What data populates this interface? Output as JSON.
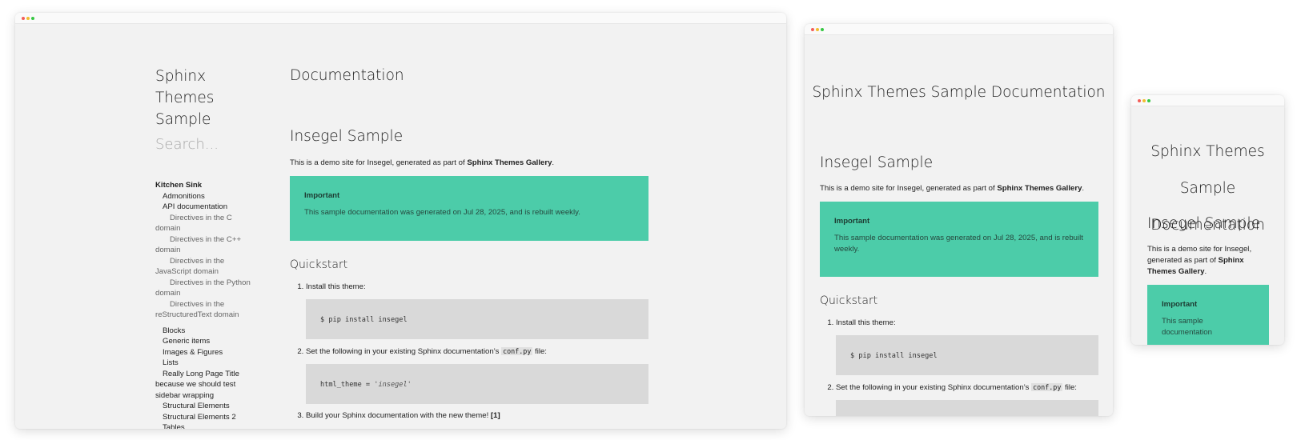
{
  "site": {
    "title": "Sphinx Themes Sample Documentation",
    "title_line1": "Sphinx Themes",
    "title_line2": "Sample",
    "doc_word": "Documentation",
    "search_placeholder": "Search..."
  },
  "sidebar": {
    "top_label": "Kitchen Sink",
    "items": [
      {
        "label": "Admonitions",
        "level": 2
      },
      {
        "label": "API documentation",
        "level": 2
      },
      {
        "label": "Directives in the C domain",
        "level": 3
      },
      {
        "label": "Directives in the C++ domain",
        "level": 3
      },
      {
        "label": "Directives in the JavaScript domain",
        "level": 3
      },
      {
        "label": "Directives in the Python domain",
        "level": 3
      },
      {
        "label": "Directives in the reStructuredText domain",
        "level": 3
      },
      {
        "label": "Blocks",
        "level": 2
      },
      {
        "label": "Generic items",
        "level": 2
      },
      {
        "label": "Images & Figures",
        "level": 2
      },
      {
        "label": "Lists",
        "level": 2
      },
      {
        "label": "Really Long Page Title because we should test sidebar wrapping",
        "level": 2
      },
      {
        "label": "Structural Elements",
        "level": 2
      },
      {
        "label": "Structural Elements 2",
        "level": 2
      },
      {
        "label": "Tables",
        "level": 2
      }
    ]
  },
  "page": {
    "heading": "Insegel Sample",
    "intro_prefix": "This is a demo site for Insegel, generated as part of ",
    "intro_link": "Sphinx Themes Gallery",
    "intro_suffix": ".",
    "admonition_title": "Important",
    "admonition_body": "This sample documentation was generated on Jul 28, 2025, and is rebuilt weekly.",
    "admonition_body_short": "This sample documentation",
    "quickstart_heading": "Quickstart",
    "step1": "Install this theme:",
    "step1_code": "$ pip install insegel",
    "step2_prefix": "Set the following in your existing Sphinx documentation’s ",
    "step2_code_inline": "conf.py",
    "step2_suffix": " file:",
    "step2_code_key": "html_theme = ",
    "step2_code_value": "'insegel'",
    "step3": "Build your Sphinx documentation with the new theme! ",
    "step3_ref": "[1]"
  },
  "colors": {
    "admonition": "#4ccca9",
    "code_bg": "#d9d9d9",
    "window_bg": "#f2f2f2"
  }
}
